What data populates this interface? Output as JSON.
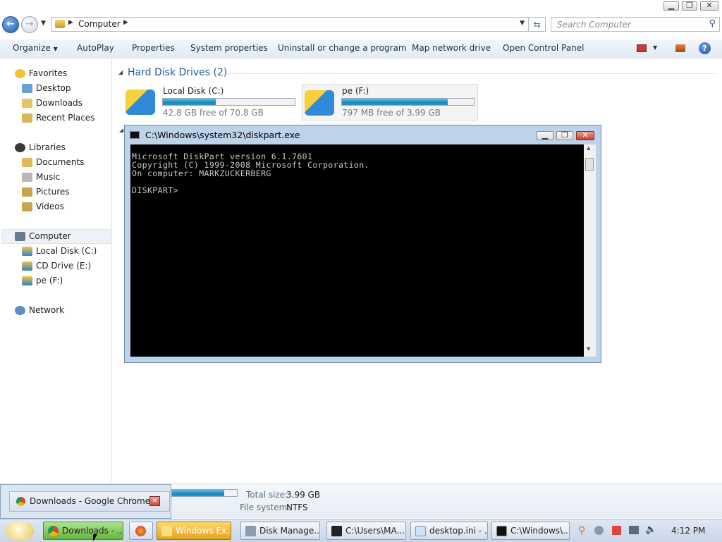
{
  "address": {
    "crumb": "Computer",
    "search_placeholder": "Search Computer"
  },
  "toolbar": {
    "organize": "Organize",
    "autoplay": "AutoPlay",
    "properties": "Properties",
    "system_properties": "System properties",
    "uninstall": "Uninstall or change a program",
    "map_drive": "Map network drive",
    "control_panel": "Open Control Panel"
  },
  "sidebar": {
    "favorites": "Favorites",
    "desktop": "Desktop",
    "downloads": "Downloads",
    "recent": "Recent Places",
    "libraries": "Libraries",
    "documents": "Documents",
    "music": "Music",
    "pictures": "Pictures",
    "videos": "Videos",
    "computer": "Computer",
    "local_c": "Local Disk (C:)",
    "cd_e": "CD Drive (E:)",
    "pe_f": "pe (F:)",
    "network": "Network"
  },
  "content": {
    "section_title": "Hard Disk Drives (2)",
    "drives": [
      {
        "name": "Local Disk (C:)",
        "free": "42.8 GB free of 70.8 GB",
        "used_fraction": 0.4
      },
      {
        "name": "pe (F:)",
        "free": "797 MB free of 3.99 GB",
        "used_fraction": 0.8
      }
    ]
  },
  "console": {
    "title": "C:\\Windows\\system32\\diskpart.exe",
    "text": "Microsoft DiskPart version 6.1.7601\nCopyright (C) 1999-2008 Microsoft Corporation.\nOn computer: MARKZUCKERBERG\n\nDISKPART> "
  },
  "details": {
    "total_label": "Total size:",
    "total_value": "3.99 GB",
    "fs_label": "File system:",
    "fs_value": "NTFS",
    "used_fraction": 0.8
  },
  "popup": {
    "label": "Downloads - Google Chrome"
  },
  "taskbar": {
    "tasks": [
      "Downloads - ...",
      "Windows Ex...",
      "Disk Manage...",
      "C:\\Users\\MA...",
      "desktop.ini - ...",
      "C:\\Windows\\..."
    ],
    "clock": "4:12 PM"
  },
  "colors": {
    "accent": "#1e86b6",
    "link": "#1e5a9e"
  }
}
